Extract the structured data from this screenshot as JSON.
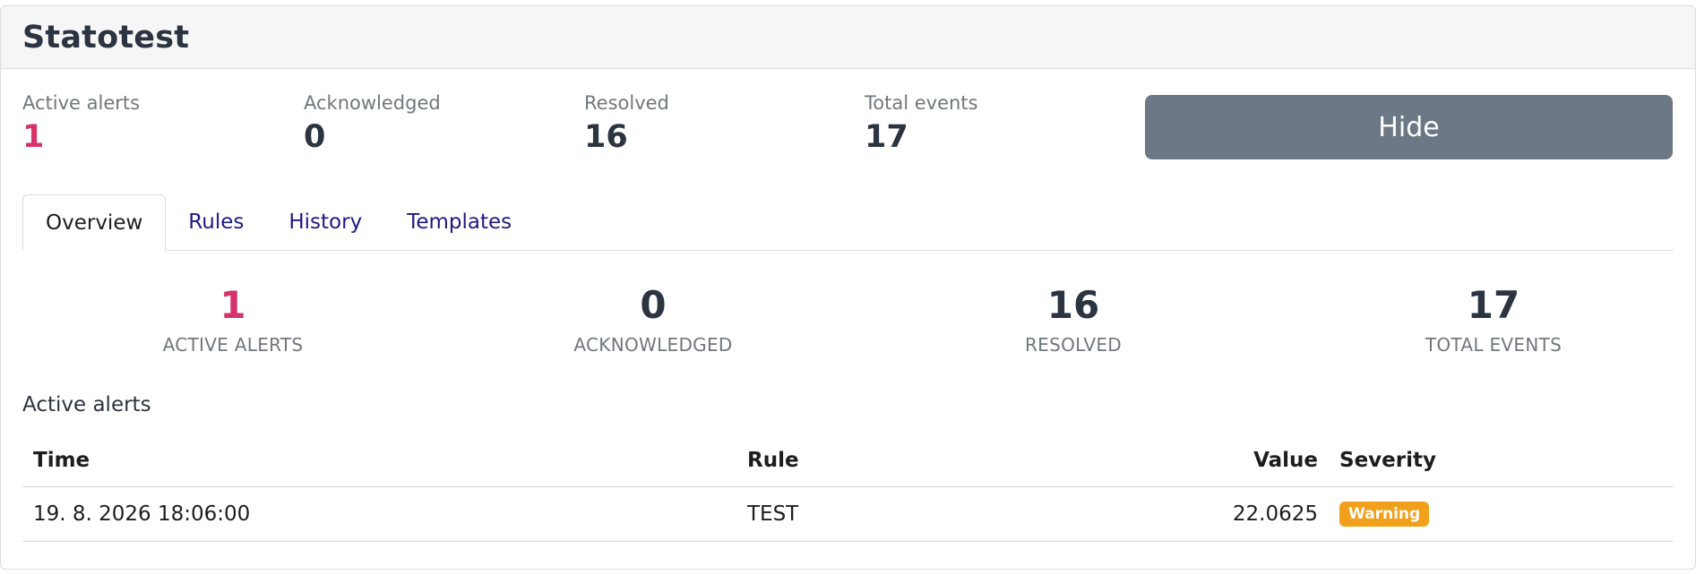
{
  "header": {
    "title": "Statotest"
  },
  "stats": [
    {
      "label": "Active alerts",
      "value": "1",
      "accent": true
    },
    {
      "label": "Acknowledged",
      "value": "0",
      "accent": false
    },
    {
      "label": "Resolved",
      "value": "16",
      "accent": false
    },
    {
      "label": "Total events",
      "value": "17",
      "accent": false
    }
  ],
  "hide_button_label": "Hide",
  "tabs": [
    {
      "label": "Overview",
      "active": true
    },
    {
      "label": "Rules",
      "active": false
    },
    {
      "label": "History",
      "active": false
    },
    {
      "label": "Templates",
      "active": false
    }
  ],
  "summary": [
    {
      "value": "1",
      "label": "ACTIVE ALERTS",
      "accent": true
    },
    {
      "value": "0",
      "label": "ACKNOWLEDGED",
      "accent": false
    },
    {
      "value": "16",
      "label": "RESOLVED",
      "accent": false
    },
    {
      "value": "17",
      "label": "TOTAL EVENTS",
      "accent": false
    }
  ],
  "active_alerts": {
    "title": "Active alerts",
    "columns": {
      "time": "Time",
      "rule": "Rule",
      "value": "Value",
      "severity": "Severity"
    },
    "rows": [
      {
        "time": "19. 8. 2026 18:06:00",
        "rule": "TEST",
        "value": "22.0625",
        "severity": "Warning"
      }
    ]
  },
  "colors": {
    "accent": "#d6336c",
    "warning": "#f0a01a",
    "button": "#6c7885",
    "link": "#1e1a82"
  }
}
